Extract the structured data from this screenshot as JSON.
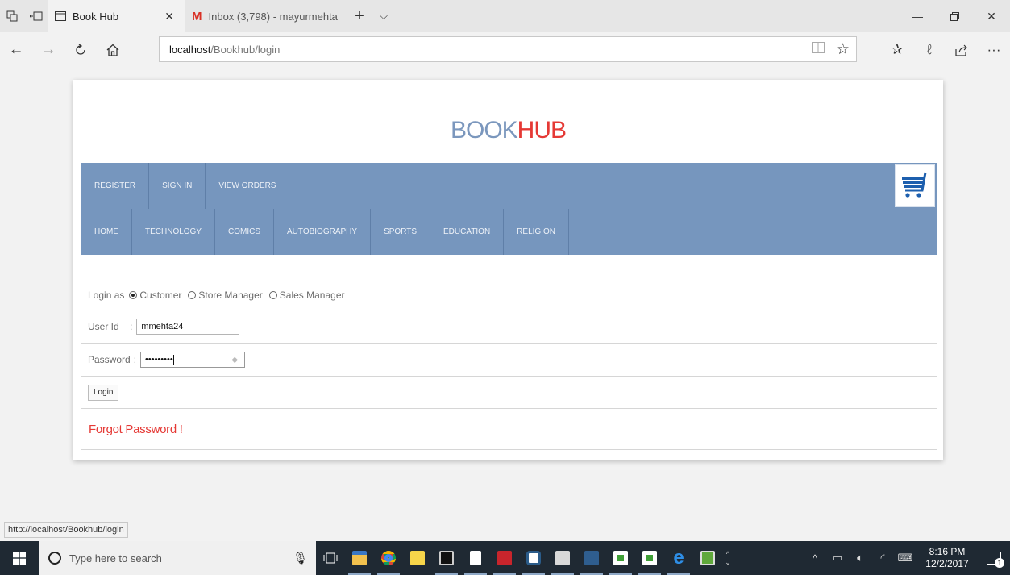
{
  "browser": {
    "tabs": [
      {
        "title": "Book Hub",
        "active": true
      },
      {
        "title": "Inbox (3,798) - mayurmehta",
        "active": false
      }
    ],
    "url": {
      "host": "localhost",
      "path": "/Bookhub/login"
    },
    "status_link": "http://localhost/Bookhub/login"
  },
  "site": {
    "logo_left": "BOOK",
    "logo_right": "HUB",
    "colors": {
      "brand_blue": "#7b97bd",
      "brand_red": "#e53935",
      "menu_bg": "#7696be"
    },
    "top_menu": [
      "REGISTER",
      "SIGN IN",
      "VIEW ORDERS"
    ],
    "category_menu": [
      "HOME",
      "TECHNOLOGY",
      "COMICS",
      "AUTOBIOGRAPHY",
      "SPORTS",
      "EDUCATION",
      "RELIGION"
    ]
  },
  "login_form": {
    "login_as_label": "Login as",
    "roles": [
      {
        "label": "Customer",
        "selected": true
      },
      {
        "label": "Store Manager",
        "selected": false
      },
      {
        "label": "Sales Manager",
        "selected": false
      }
    ],
    "user_id_label": "User Id",
    "user_id_value": "mmehta24",
    "password_label": "Password",
    "password_value": "•••••••••",
    "colon": ":",
    "login_button": "Login",
    "forgot_link": "Forgot Password !"
  },
  "taskbar": {
    "search_placeholder": "Type here to search",
    "time": "8:16 PM",
    "date": "12/2/2017",
    "notification_count": "1"
  }
}
